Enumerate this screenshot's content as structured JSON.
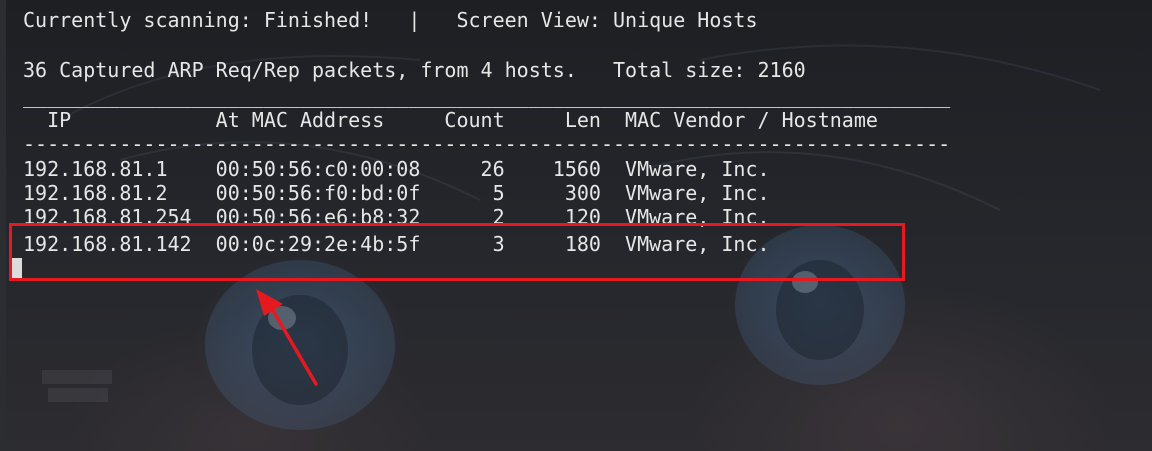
{
  "terminal": {
    "status_line": "Currently scanning: Finished!   |   Screen View: Unique Hosts",
    "summary_line": "36 Captured ARP Req/Rep packets, from 4 hosts.   Total size: 2160",
    "rule_top": "_____________________________________________________________________________",
    "header_line": "  IP            At MAC Address     Count     Len  MAC Vendor / Hostname",
    "rule_bottom": "-----------------------------------------------------------------------------",
    "rows": [
      "192.168.81.1    00:50:56:c0:00:08     26    1560  VMware, Inc.",
      "192.168.81.2    00:50:56:f0:bd:0f      5     300  VMware, Inc.",
      "192.168.81.254  00:50:56:e6:b8:32      2     120  VMware, Inc.",
      "192.168.81.142  00:0c:29:2e:4b:5f      3     180  VMware, Inc."
    ]
  },
  "annotation": {
    "box_color": "#e5191f",
    "arrow_color": "#e5191f"
  },
  "colors": {
    "terminal_text": "#e6e6e6",
    "background": "#1f2126"
  }
}
